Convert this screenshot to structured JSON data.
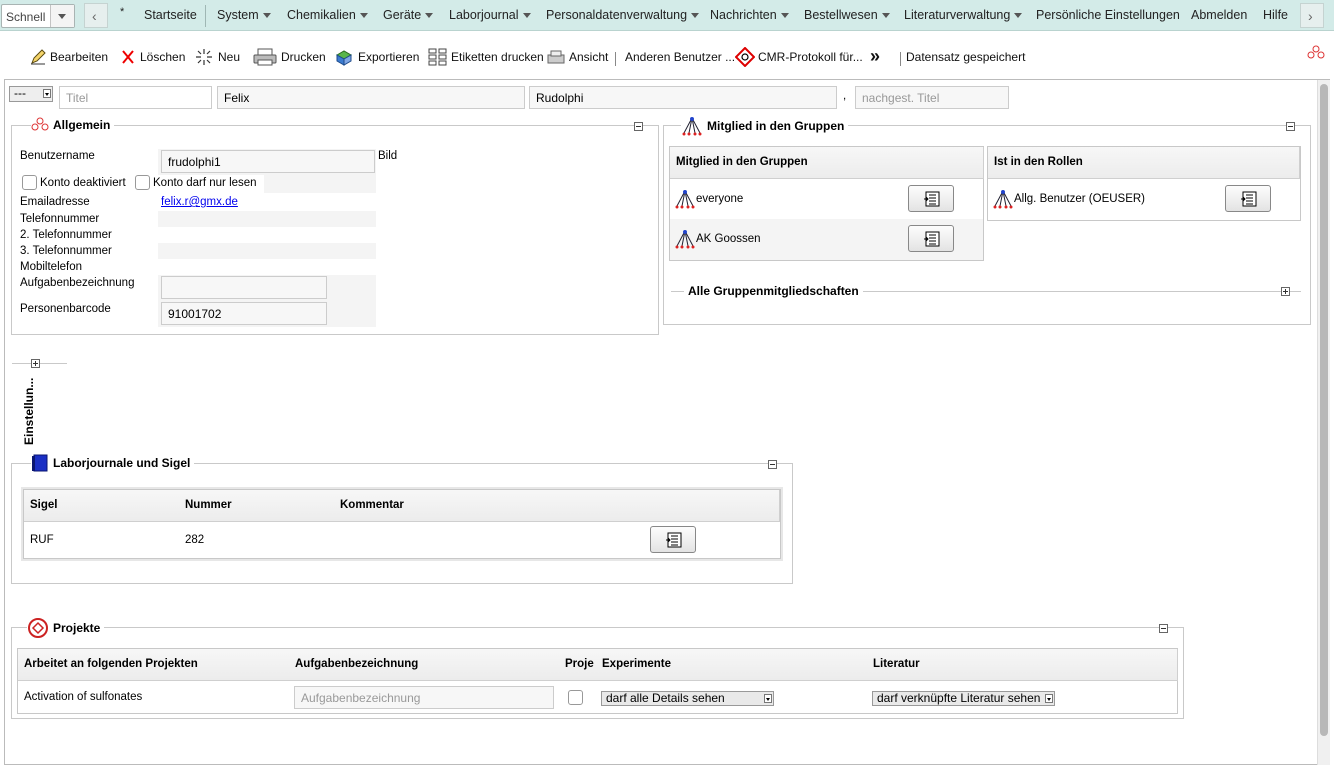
{
  "menubar": {
    "quick": "Schnell",
    "star": "*",
    "items": [
      "Startseite",
      "System",
      "Chemikalien",
      "Geräte",
      "Laborjournal",
      "Personaldatenverwaltung",
      "Nachrichten",
      "Bestellwesen",
      "Literaturverwaltung",
      "Persönliche Einstellungen",
      "Abmelden",
      "Hilfe"
    ]
  },
  "toolbar": {
    "edit": "Bearbeiten",
    "delete": "Löschen",
    "new": "Neu",
    "print": "Drucken",
    "export": "Exportieren",
    "labels": "Etiketten drucken",
    "view": "Ansicht",
    "other_user": "Anderen Benutzer ...",
    "cmr": "CMR-Protokoll für...",
    "more": "»",
    "status": "Datensatz gespeichert"
  },
  "name_row": {
    "prefix_select": "---",
    "title_placeholder": "Titel",
    "first_name": "Felix",
    "last_name": "Rudolphi",
    "comma": ",",
    "suffix_placeholder": "nachgest. Titel"
  },
  "allgemein": {
    "legend": "Allgemein",
    "username_label": "Benutzername",
    "username": "frudolphi1",
    "image_label": "Bild",
    "disabled_label": "Konto deaktiviert",
    "readonly_label": "Konto darf nur lesen",
    "email_label": "Emailadresse",
    "email": "felix.r@gmx.de",
    "phone_label": "Telefonnummer",
    "phone2_label": "2. Telefonnummer",
    "phone3_label": "3. Telefonnummer",
    "mobile_label": "Mobiltelefon",
    "task_label": "Aufgabenbezeichnung",
    "barcode_label": "Personenbarcode",
    "barcode": "91001702"
  },
  "groups": {
    "legend": "Mitglied in den Gruppen",
    "col_member": "Mitglied in den Gruppen",
    "members": [
      "everyone",
      "AK Goossen"
    ],
    "col_roles": "Ist in den Rollen",
    "roles": [
      "Allg. Benutzer (OEUSER)"
    ],
    "all_memberships": "Alle Gruppenmitgliedschaften"
  },
  "settings": {
    "label": "Einstellun..."
  },
  "journals": {
    "legend": "Laborjournale und Sigel",
    "headers": [
      "Sigel",
      "Nummer",
      "Kommentar",
      ""
    ],
    "rows": [
      {
        "sigel": "RUF",
        "number": "282",
        "comment": ""
      }
    ]
  },
  "projects": {
    "legend": "Projekte",
    "headers": [
      "Arbeitet an folgenden Projekten",
      "Aufgabenbezeichnung",
      "Proje",
      "Experimente",
      "Literatur",
      ""
    ],
    "rows": [
      {
        "project": "Activation of sulfonates",
        "task_placeholder": "Aufgabenbezeichnung",
        "experiments": "darf alle Details sehen",
        "literature": "darf verknüpfte Literatur sehen"
      }
    ]
  }
}
